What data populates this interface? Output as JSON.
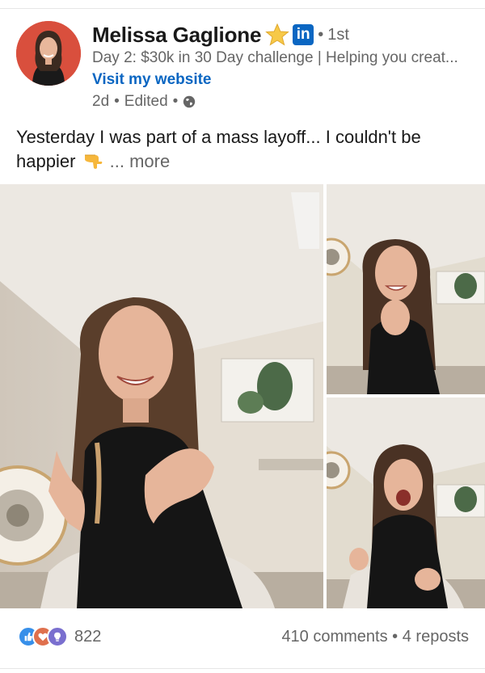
{
  "post": {
    "author": {
      "name": "Melissa Gaglione",
      "degree": "1st",
      "headline": "Day 2: $30k in 30 Day challenge | Helping you creat...",
      "website_label": "Visit my website",
      "time": "2d",
      "edited": "Edited",
      "icons": [
        "star-icon",
        "linkedin-icon",
        "globe-icon"
      ]
    },
    "text": {
      "line1": "Yesterday I was part of a mass layoff... I couldn't be",
      "line2": "happier",
      "more": "... more",
      "emoji": "pointing-down-hand-icon"
    },
    "media": {
      "count": 3,
      "photos": [
        "photo-main",
        "photo-top-right",
        "photo-bottom-right"
      ]
    },
    "social": {
      "reaction_icons": [
        "like-icon",
        "love-icon",
        "insightful-icon"
      ],
      "reactions_count": "822",
      "comments": "410 comments",
      "reposts": "4 reposts"
    },
    "colors": {
      "link": "#0a66c2",
      "secondary_text": "#666666",
      "primary_text": "#191919"
    }
  }
}
